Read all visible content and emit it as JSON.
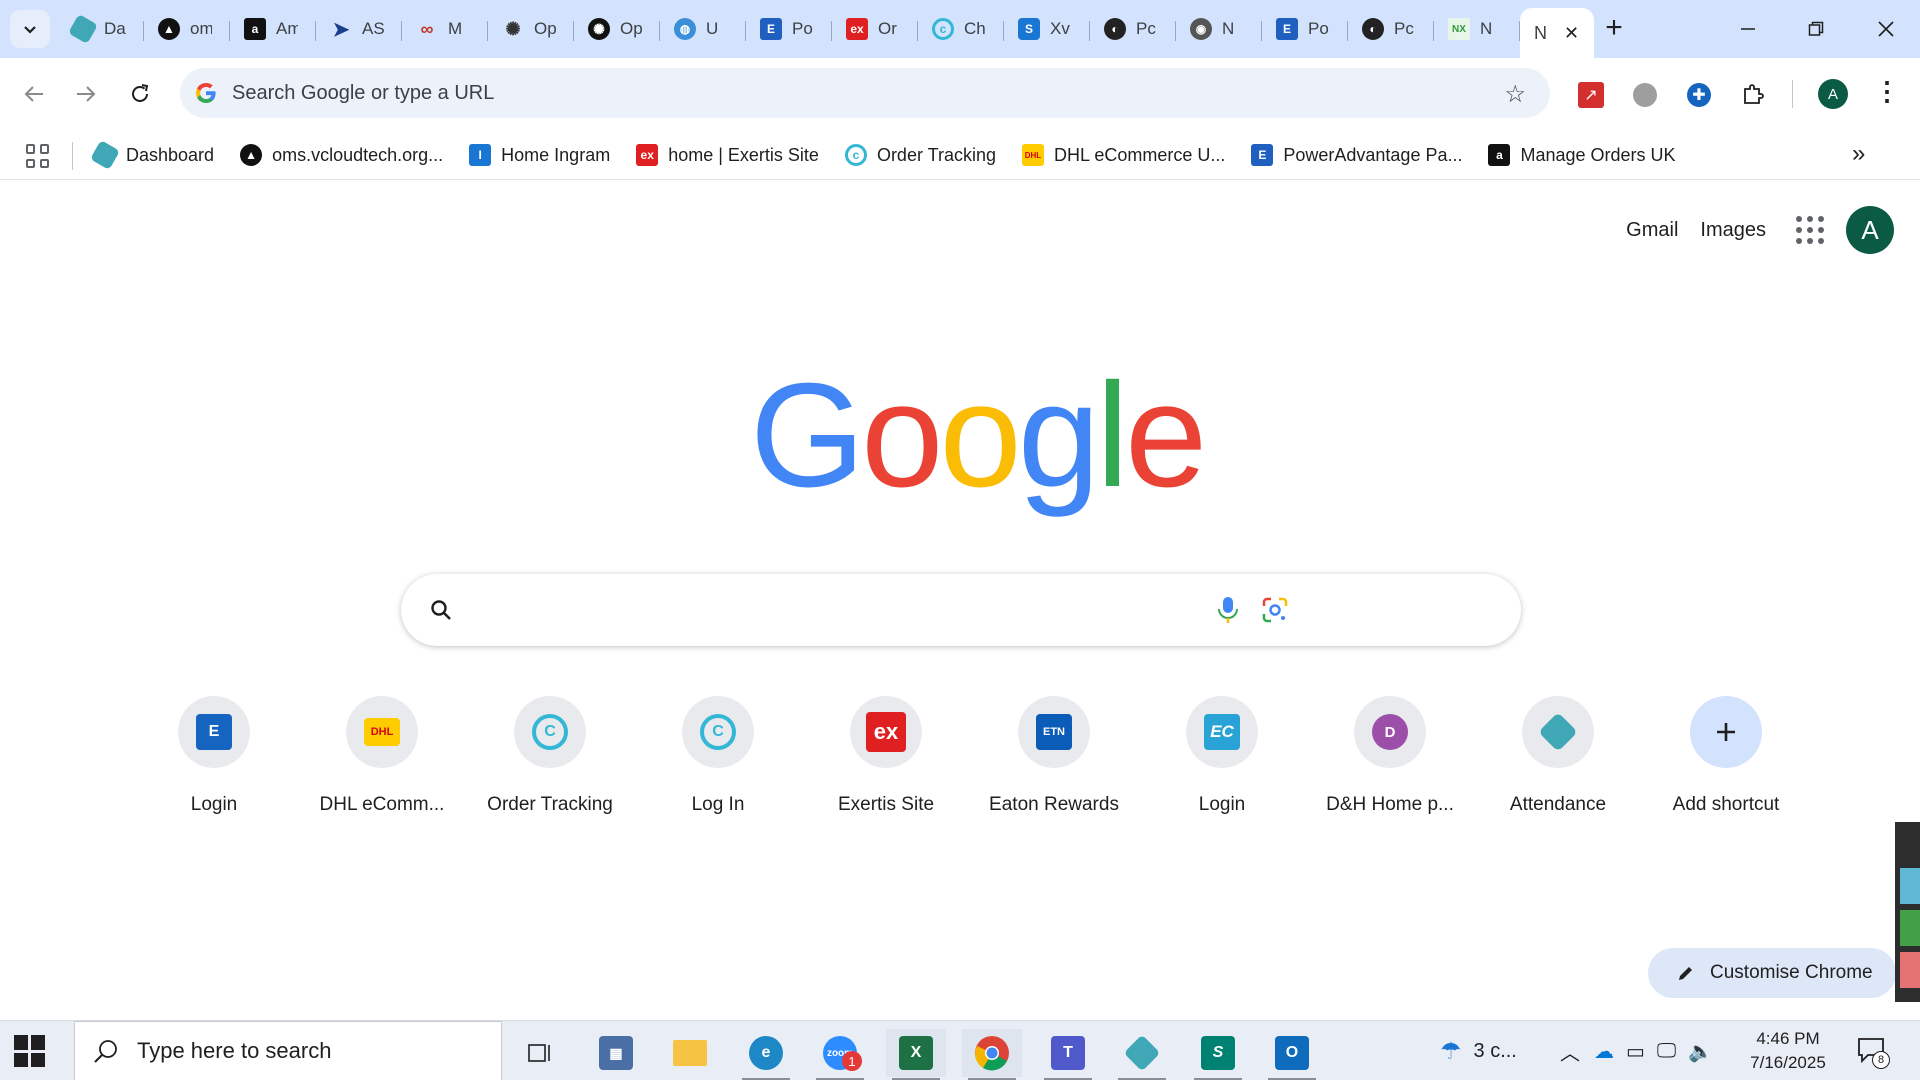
{
  "browser": {
    "tabs": [
      {
        "title": "Dashboard",
        "icon": "hexagon-teal-icon",
        "color": "#3fa7b5"
      },
      {
        "title": "oms",
        "icon": "triangle-black-icon",
        "color": "#111111"
      },
      {
        "title": "Amazon",
        "icon": "amazon-icon",
        "color": "#111111"
      },
      {
        "title": "AS",
        "icon": "arrow-blue-icon",
        "color": "#1a3f8f"
      },
      {
        "title": "M",
        "icon": "rings-icon",
        "color": "#c0392b"
      },
      {
        "title": "OpenAI",
        "icon": "openai-icon",
        "color": "#333333"
      },
      {
        "title": "OpenAI",
        "icon": "openai-icon",
        "color": "#111111"
      },
      {
        "title": "U",
        "icon": "globe-blue-icon",
        "color": "#3b8fd9"
      },
      {
        "title": "Po",
        "icon": "e-blue-icon",
        "color": "#1f5fbf"
      },
      {
        "title": "Or",
        "icon": "ex-red-icon",
        "color": "#e02020"
      },
      {
        "title": "Ch",
        "icon": "swirl-teal-icon",
        "color": "#34b7d6"
      },
      {
        "title": "Xv",
        "icon": "puzzle-blue-icon",
        "color": "#1976d2"
      },
      {
        "title": "Pc",
        "icon": "bird-dark-icon",
        "color": "#222222"
      },
      {
        "title": "N",
        "icon": "chrome-gray-icon",
        "color": "#555555"
      },
      {
        "title": "Po",
        "icon": "e-blue-icon",
        "color": "#1f5fbf"
      },
      {
        "title": "Pc",
        "icon": "bird-dark-icon",
        "color": "#222222"
      },
      {
        "title": "N",
        "icon": "nx-nippon-icon",
        "color": "#2e9c3a"
      }
    ],
    "active_tab": {
      "title": "N"
    },
    "omnibox_placeholder": "Search Google or type a URL",
    "bookmarks": [
      {
        "label": "Dashboard",
        "icon": "hexagon-teal-icon",
        "color": "#3fa7b5"
      },
      {
        "label": "oms.vcloudtech.org...",
        "icon": "triangle-black-icon",
        "color": "#111111"
      },
      {
        "label": "Home Ingram",
        "icon": "ingram-icon",
        "color": "#1976d2"
      },
      {
        "label": "home | Exertis Site",
        "icon": "ex-red-icon",
        "color": "#e02020"
      },
      {
        "label": "Order Tracking",
        "icon": "swirl-teal-icon",
        "color": "#34b7d6"
      },
      {
        "label": "DHL eCommerce U...",
        "icon": "dhl-icon",
        "color": "#ffcc00"
      },
      {
        "label": "PowerAdvantage Pa...",
        "icon": "e-blue-icon",
        "color": "#1f5fbf"
      },
      {
        "label": "Manage Orders UK",
        "icon": "amazon-icon",
        "color": "#111111"
      }
    ]
  },
  "ntp": {
    "gmail": "Gmail",
    "images": "Images",
    "avatar_letter": "A",
    "logo_letters": [
      "G",
      "o",
      "o",
      "g",
      "l",
      "e"
    ],
    "logo_colors": [
      "#4285f4",
      "#ea4335",
      "#fbbc05",
      "#4285f4",
      "#34a853",
      "#ea4335"
    ],
    "shortcuts": [
      {
        "label": "Login",
        "icon": "e-blue-icon",
        "color": "#1565c0",
        "glyph": "E"
      },
      {
        "label": "DHL eComm...",
        "icon": "dhl-icon",
        "color": "#ffcc00",
        "glyph": "DHL"
      },
      {
        "label": "Order Tracking",
        "icon": "swirl-teal-icon",
        "color": "#34b7d6",
        "glyph": "C"
      },
      {
        "label": "Log In",
        "icon": "swirl-teal-icon",
        "color": "#34b7d6",
        "glyph": "C"
      },
      {
        "label": "Exertis Site",
        "icon": "ex-red-icon",
        "color": "#e02020",
        "glyph": "ex"
      },
      {
        "label": "Eaton Rewards",
        "icon": "etn-icon",
        "color": "#0a5cb8",
        "glyph": "ETN"
      },
      {
        "label": "Login",
        "icon": "ec-icon",
        "color": "#29a3d6",
        "glyph": "EC"
      },
      {
        "label": "D&H Home p...",
        "icon": "d-letter-icon",
        "color": "#9c4fa8",
        "glyph": "D"
      },
      {
        "label": "Attendance",
        "icon": "hexagon-teal-icon",
        "color": "#3fa7b5",
        "glyph": ""
      }
    ],
    "add_shortcut": "Add shortcut",
    "customise": "Customise Chrome"
  },
  "taskbar": {
    "search_placeholder": "Type here to search",
    "weather": "3 c...",
    "time": "4:46 PM",
    "date": "7/16/2025",
    "notifications": "8",
    "zoom_badge": "1"
  }
}
